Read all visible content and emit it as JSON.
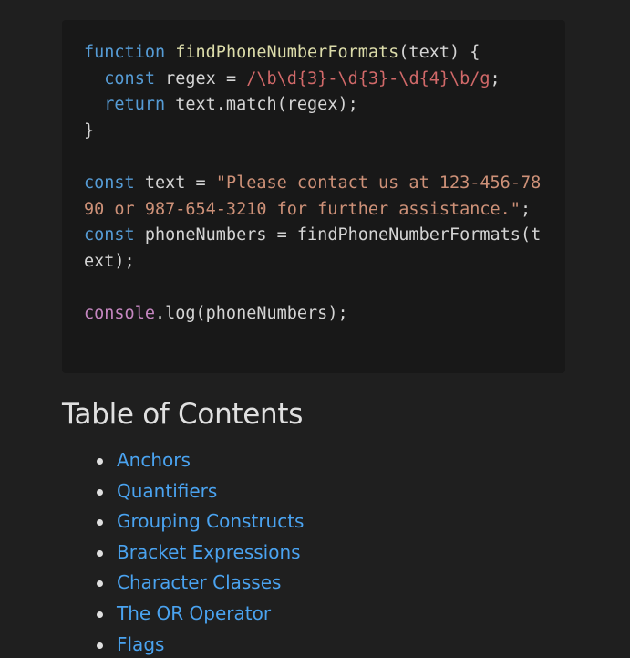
{
  "code": {
    "line1": {
      "kw": "function",
      "name": "findPhoneNumberFormats",
      "rest": "(text) {"
    },
    "line2": {
      "kw": "const",
      "mid": " regex = ",
      "regex": "/\\b\\d{3}-\\d{3}-\\d{4}\\b/g",
      "end": ";"
    },
    "line3": {
      "kw": "return",
      "rest": " text.match(regex);"
    },
    "line4": "}",
    "line6": {
      "kw": "const",
      "mid": " text = ",
      "string": "\"Please contact us at 123-456-7890 or 987-654-3210 for further assistance.\"",
      "end": ";"
    },
    "line7": {
      "kw": "const",
      "rest": " phoneNumbers = findPhoneNumberFormats(text);"
    },
    "line9": {
      "obj": "console",
      "rest": ".log(phoneNumbers);"
    }
  },
  "toc": {
    "title": "Table of Contents",
    "items": [
      "Anchors",
      "Quantifiers",
      "Grouping Constructs",
      "Bracket Expressions",
      "Character Classes",
      "The OR Operator",
      "Flags"
    ]
  }
}
